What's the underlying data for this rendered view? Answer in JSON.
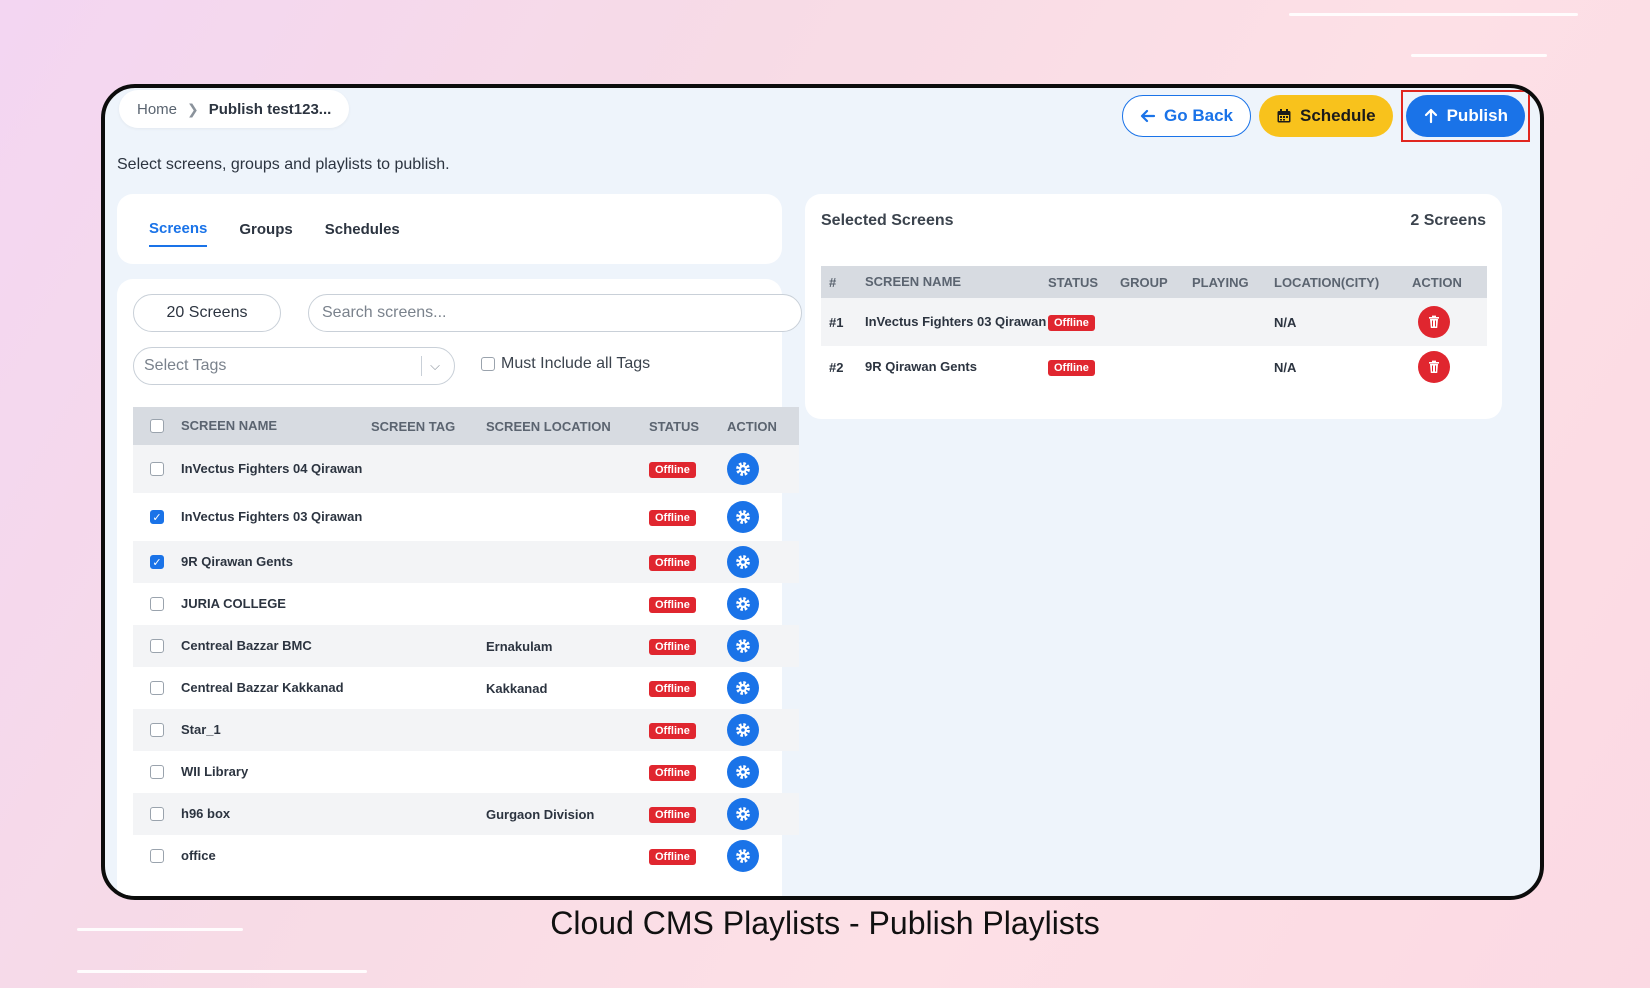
{
  "breadcrumb": {
    "home": "Home",
    "current": "Publish test123..."
  },
  "actions": {
    "go_back": "Go Back",
    "schedule": "Schedule",
    "publish": "Publish"
  },
  "subtitle": "Select screens, groups and playlists to publish.",
  "tabs": [
    {
      "label": "Screens",
      "active": true
    },
    {
      "label": "Groups",
      "active": false
    },
    {
      "label": "Schedules",
      "active": false
    }
  ],
  "screens_count": "20 Screens",
  "search": {
    "placeholder": "Search screens..."
  },
  "tags_select": {
    "placeholder": "Select Tags"
  },
  "must_include_label": "Must Include all Tags",
  "screen_table": {
    "headers": [
      "SCREEN NAME",
      "SCREEN TAG",
      "SCREEN LOCATION",
      "STATUS",
      "ACTION"
    ],
    "rows": [
      {
        "name": "InVectus Fighters 04 Qirawan",
        "tag": "",
        "location": "",
        "status": "Offline",
        "checked": false
      },
      {
        "name": "InVectus Fighters 03 Qirawan",
        "tag": "",
        "location": "",
        "status": "Offline",
        "checked": true
      },
      {
        "name": "9R Qirawan Gents",
        "tag": "",
        "location": "",
        "status": "Offline",
        "checked": true
      },
      {
        "name": "JURIA COLLEGE",
        "tag": "",
        "location": "",
        "status": "Offline",
        "checked": false
      },
      {
        "name": "Centreal Bazzar BMC",
        "tag": "",
        "location": "Ernakulam",
        "status": "Offline",
        "checked": false
      },
      {
        "name": "Centreal Bazzar Kakkanad",
        "tag": "",
        "location": "Kakkanad",
        "status": "Offline",
        "checked": false
      },
      {
        "name": "Star_1",
        "tag": "",
        "location": "",
        "status": "Offline",
        "checked": false
      },
      {
        "name": "WII Library",
        "tag": "",
        "location": "",
        "status": "Offline",
        "checked": false
      },
      {
        "name": "h96 box",
        "tag": "",
        "location": "Gurgaon Division",
        "status": "Offline",
        "checked": false
      },
      {
        "name": "office",
        "tag": "",
        "location": "",
        "status": "Offline",
        "checked": false
      }
    ]
  },
  "selected": {
    "title": "Selected Screens",
    "count": "2 Screens",
    "headers": [
      "#",
      "SCREEN NAME",
      "STATUS",
      "GROUP",
      "PLAYING",
      "LOCATION(CITY)",
      "ACTION"
    ],
    "rows": [
      {
        "num": "#1",
        "name": "InVectus Fighters 03 Qirawan",
        "status": "Offline",
        "group": "",
        "playing": "",
        "location": "N/A"
      },
      {
        "num": "#2",
        "name": "9R Qirawan Gents",
        "status": "Offline",
        "group": "",
        "playing": "",
        "location": "N/A"
      }
    ]
  },
  "caption": "Cloud CMS Playlists - Publish Playlists",
  "colors": {
    "primary": "#1a73e8",
    "schedule": "#f8c21c",
    "danger": "#e0262f",
    "highlight": "#e0261f"
  },
  "icons": {
    "go_back": "arrow-left-icon",
    "schedule": "calendar-icon",
    "publish": "arrow-up-icon",
    "row_action": "gear-icon",
    "delete": "trash-icon"
  }
}
